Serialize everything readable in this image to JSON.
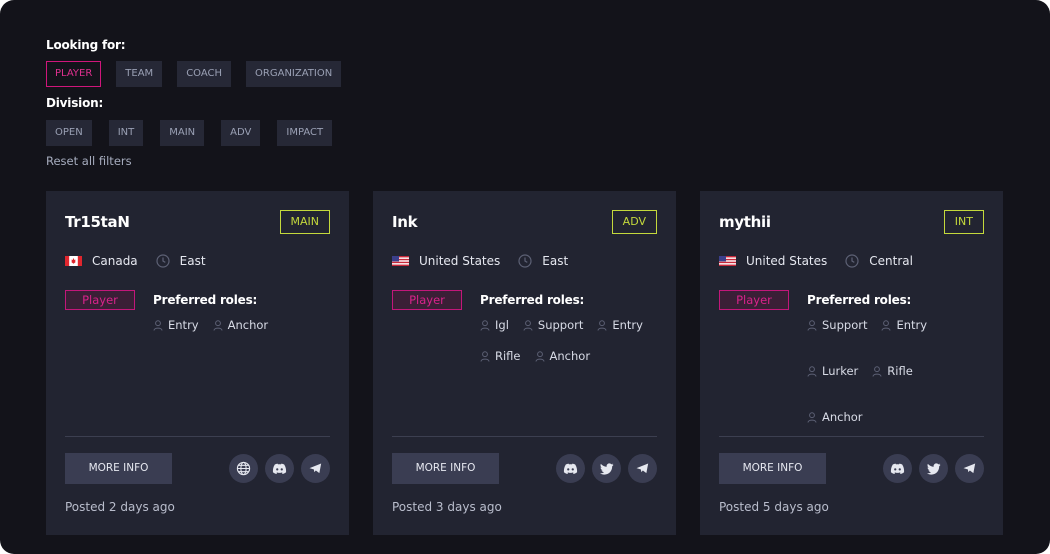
{
  "filters": {
    "looking_for_label": "Looking for:",
    "looking_for": [
      "PLAYER",
      "TEAM",
      "COACH",
      "ORGANIZATION"
    ],
    "looking_for_active": "PLAYER",
    "division_label": "Division:",
    "divisions": [
      "OPEN",
      "INT",
      "MAIN",
      "ADV",
      "IMPACT"
    ],
    "reset_label": "Reset all filters"
  },
  "colors": {
    "background": "#13131a",
    "card": "#222431",
    "accent_pink": "#d0167b",
    "division_green": "#c4d93c",
    "button": "#3a3d52"
  },
  "cards": [
    {
      "name": "Tr15taN",
      "division": "MAIN",
      "country": "Canada",
      "flag": "canada-flag-icon",
      "region": "East",
      "type": "Player",
      "preferred_label": "Preferred roles:",
      "roles": [
        "Entry",
        "Anchor"
      ],
      "more_label": "MORE INFO",
      "socials": [
        "globe-icon",
        "discord-icon",
        "telegram-icon"
      ],
      "posted": "Posted 2 days ago"
    },
    {
      "name": "Ink",
      "division": "ADV",
      "country": "United States",
      "flag": "usa-flag-icon",
      "region": "East",
      "type": "Player",
      "preferred_label": "Preferred roles:",
      "roles": [
        "Igl",
        "Support",
        "Entry",
        "Rifle",
        "Anchor"
      ],
      "more_label": "MORE INFO",
      "socials": [
        "discord-icon",
        "twitter-icon",
        "telegram-icon"
      ],
      "posted": "Posted 3 days ago"
    },
    {
      "name": "mythii",
      "division": "INT",
      "country": "United States",
      "flag": "usa-flag-icon",
      "region": "Central",
      "type": "Player",
      "preferred_label": "Preferred roles:",
      "roles": [
        "Support",
        "Entry",
        "Lurker",
        "Rifle",
        "Anchor"
      ],
      "more_label": "MORE INFO",
      "socials": [
        "discord-icon",
        "twitter-icon",
        "telegram-icon"
      ],
      "posted": "Posted 5 days ago"
    }
  ]
}
